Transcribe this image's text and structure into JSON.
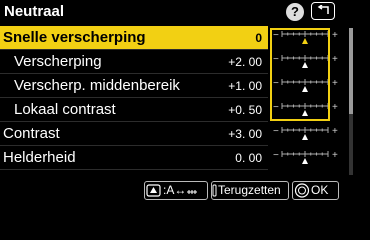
{
  "header": {
    "title": "Neutraal",
    "help_icon_label": "?"
  },
  "rows": [
    {
      "label": "Snelle verscherping",
      "value": "0",
      "level": 0.5,
      "selected": true
    },
    {
      "label": "Verscherping",
      "value": "+2. 00",
      "level": 0.5
    },
    {
      "label": "Verscherp. middenbereik",
      "value": "+1. 00",
      "level": 0.5
    },
    {
      "label": "Lokaal contrast",
      "value": "+0. 50",
      "level": 0.5
    },
    {
      "label": "Contrast",
      "value": "+3. 00",
      "level": 0.5
    },
    {
      "label": "Helderheid",
      "value": "0. 00",
      "level": 0.5
    }
  ],
  "footer": {
    "mode_label": ":A↔",
    "reset_label": "Terugzetten",
    "ok_label": "OK"
  }
}
